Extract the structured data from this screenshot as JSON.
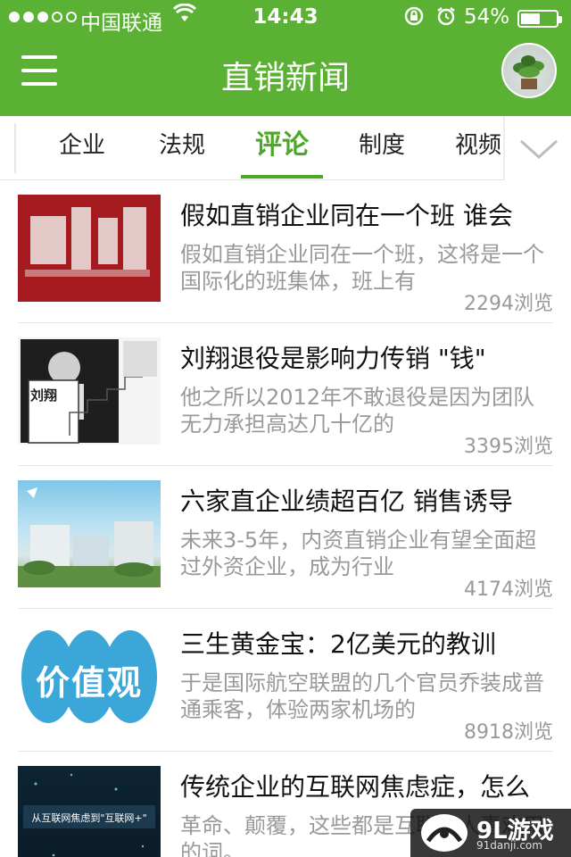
{
  "status_bar": {
    "carrier": "中国联通",
    "time": "14:43",
    "battery_percent_text": "54%",
    "battery_level": 0.54,
    "signal_bars_filled": 3,
    "signal_bars_total": 5,
    "icons": [
      "wifi-icon",
      "orientation-lock-icon",
      "alarm-icon",
      "battery-icon"
    ]
  },
  "header": {
    "title": "直销新闻",
    "menu_icon": "hamburger-menu-icon",
    "avatar_icon": "plant-avatar"
  },
  "tabs": {
    "items": [
      {
        "label": "企业",
        "active": false
      },
      {
        "label": "法规",
        "active": false
      },
      {
        "label": "评论",
        "active": true
      },
      {
        "label": "制度",
        "active": false
      },
      {
        "label": "视频",
        "active": false
      }
    ],
    "more_icon": "chevron-down-icon"
  },
  "articles": [
    {
      "title": "假如直销企业同在一个班 谁会",
      "summary": "假如直销企业同在一个班，这将是一个国际化的班集体，班上有",
      "views": "2294",
      "views_unit": "浏览"
    },
    {
      "title": "刘翔退役是影响力传销 \"钱\"",
      "summary": "他之所以2012年不敢退役是因为团队无力承担高达几十亿的",
      "views": "3395",
      "views_unit": "浏览",
      "thumb_text": "刘翔"
    },
    {
      "title": "六家直企业绩超百亿 销售诱导",
      "summary": "未来3-5年，内资直销企业有望全面超过外资企业，成为行业",
      "views": "4174",
      "views_unit": "浏览"
    },
    {
      "title": "三生黄金宝：2亿美元的教训",
      "summary": "于是国际航空联盟的几个官员乔装成普通乘客，体验两家机场的",
      "views": "8918",
      "views_unit": "浏览",
      "thumb_text": "价值观"
    },
    {
      "title": "传统企业的互联网焦虑症，怎么",
      "summary": "革命、颠覆，这些都是互联网人喜欢用的词。",
      "views": "",
      "views_unit": "",
      "thumb_text": "从互联网焦虑到\"互联网+\""
    }
  ],
  "watermark": {
    "logo": "9L游戏",
    "url": "91danji.com"
  },
  "colors": {
    "brand_green": "#5bb133",
    "tab_active": "#4ca826",
    "text_dark": "#111111",
    "text_gray": "#999999"
  }
}
